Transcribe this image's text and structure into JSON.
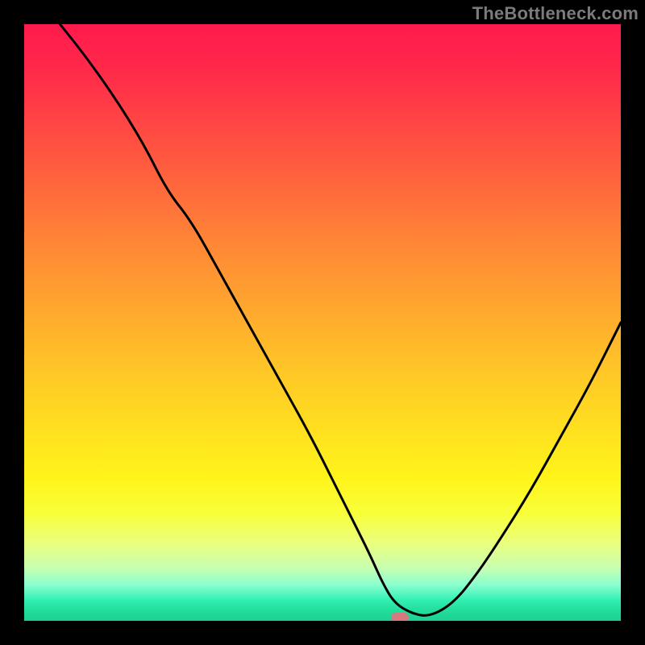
{
  "attribution": "TheBottleneck.com",
  "chart_data": {
    "type": "line",
    "title": "",
    "xlabel": "",
    "ylabel": "",
    "xlim": [
      0,
      100
    ],
    "ylim": [
      0,
      100
    ],
    "x": [
      6,
      10,
      15,
      20,
      24,
      28,
      33,
      38,
      43,
      48,
      52,
      55,
      58,
      60,
      62,
      65,
      68,
      72,
      76,
      80,
      85,
      90,
      95,
      100
    ],
    "values": [
      100,
      95,
      88,
      80,
      72,
      67,
      58,
      49,
      40,
      31,
      23,
      17,
      11,
      6.5,
      3,
      1.2,
      0.7,
      3,
      8,
      14,
      22,
      31,
      40,
      50
    ],
    "flat_region_x": [
      58,
      66
    ],
    "marker": {
      "x": 63,
      "y": 0.6
    },
    "gradient_stops": [
      {
        "pos": 0,
        "color": "#ff1a4d"
      },
      {
        "pos": 50,
        "color": "#ffc627"
      },
      {
        "pos": 80,
        "color": "#fff41a"
      },
      {
        "pos": 100,
        "color": "#1ad192"
      }
    ]
  }
}
